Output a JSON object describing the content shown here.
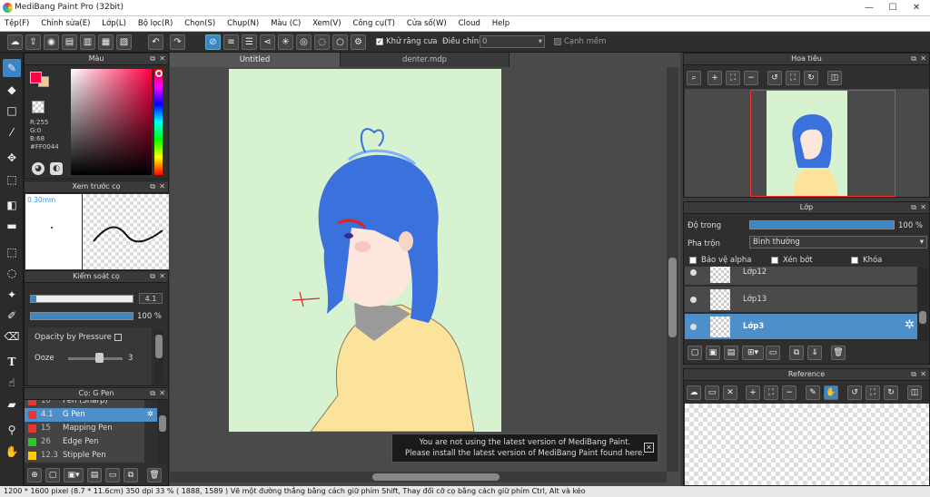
{
  "app": {
    "title": "MediBang Paint Pro (32bit)",
    "minimize": "—",
    "maximize": "☐",
    "close": "✕"
  },
  "menu": [
    "Tệp(F)",
    "Chỉnh sửa(E)",
    "Lớp(L)",
    "Bộ lọc(R)",
    "Chọn(S)",
    "Chụp(N)",
    "Màu (C)",
    "Xem(V)",
    "Công cụ(T)",
    "Cửa số(W)",
    "Cloud",
    "Help"
  ],
  "toolbar": {
    "antialias_label": "Khử răng cưa",
    "correction_label": "Điều chỉnh",
    "correction_value": "0",
    "sharp_edge_label": "Cạnh mềm"
  },
  "color_panel": {
    "title": "Màu",
    "r": "R:255",
    "g": "G:0",
    "b": "B:68",
    "hex": "#FF0044",
    "fg": "#ff0044",
    "bg": "#f4c9a0"
  },
  "brush_preview": {
    "title": "Xem trước cọ",
    "size": "0.30mm"
  },
  "brush_control": {
    "title": "Kiểm soát cọ",
    "size_value": "4.1",
    "opacity_value": "100 %",
    "opacity": 1.0,
    "pressure_label": "Opacity by Pressure",
    "ooze_label": "Ooze",
    "ooze_value": "3"
  },
  "brush_list": {
    "title": "Cọ: G Pen",
    "items": [
      {
        "size": "10",
        "name": "Pen (Sharp)",
        "color": "#e33"
      },
      {
        "size": "4.1",
        "name": "G Pen",
        "color": "#e33"
      },
      {
        "size": "15",
        "name": "Mapping Pen",
        "color": "#e33"
      },
      {
        "size": "26",
        "name": "Edge Pen",
        "color": "#2c2"
      },
      {
        "size": "12.3",
        "name": "Stipple Pen",
        "color": "#fc0"
      }
    ]
  },
  "tabs": [
    {
      "label": "Untitled"
    },
    {
      "label": "denter.mdp"
    }
  ],
  "notification": {
    "line1": "You are not using the latest version of MediBang Paint.",
    "line2": "Please install the latest version of MediBang Paint found here."
  },
  "navigator": {
    "title": "Hoa tiêu"
  },
  "layers": {
    "title": "Lớp",
    "opacity_label": "Độ trong",
    "opacity_value": "100 %",
    "opacity": 1.0,
    "blend_label": "Pha trộn",
    "blend_value": "Bình thường",
    "protect_alpha": "Bảo vệ alpha",
    "clipping": "Xén bớt",
    "lock": "Khóa",
    "items": [
      {
        "name": "Lớp12"
      },
      {
        "name": "Lớp13"
      },
      {
        "name": "Lớp3"
      }
    ]
  },
  "reference": {
    "title": "Reference"
  },
  "status": {
    "text": "1200 * 1600 pixel   (8.7 * 11.6cm)   350 dpi   33 %   ( 1888, 1589 )   Vẽ một đường thẳng bằng cách giữ phím Shift, Thay đổi cỡ cọ bằng cách giữ phím Ctrl, Alt và kéo"
  }
}
